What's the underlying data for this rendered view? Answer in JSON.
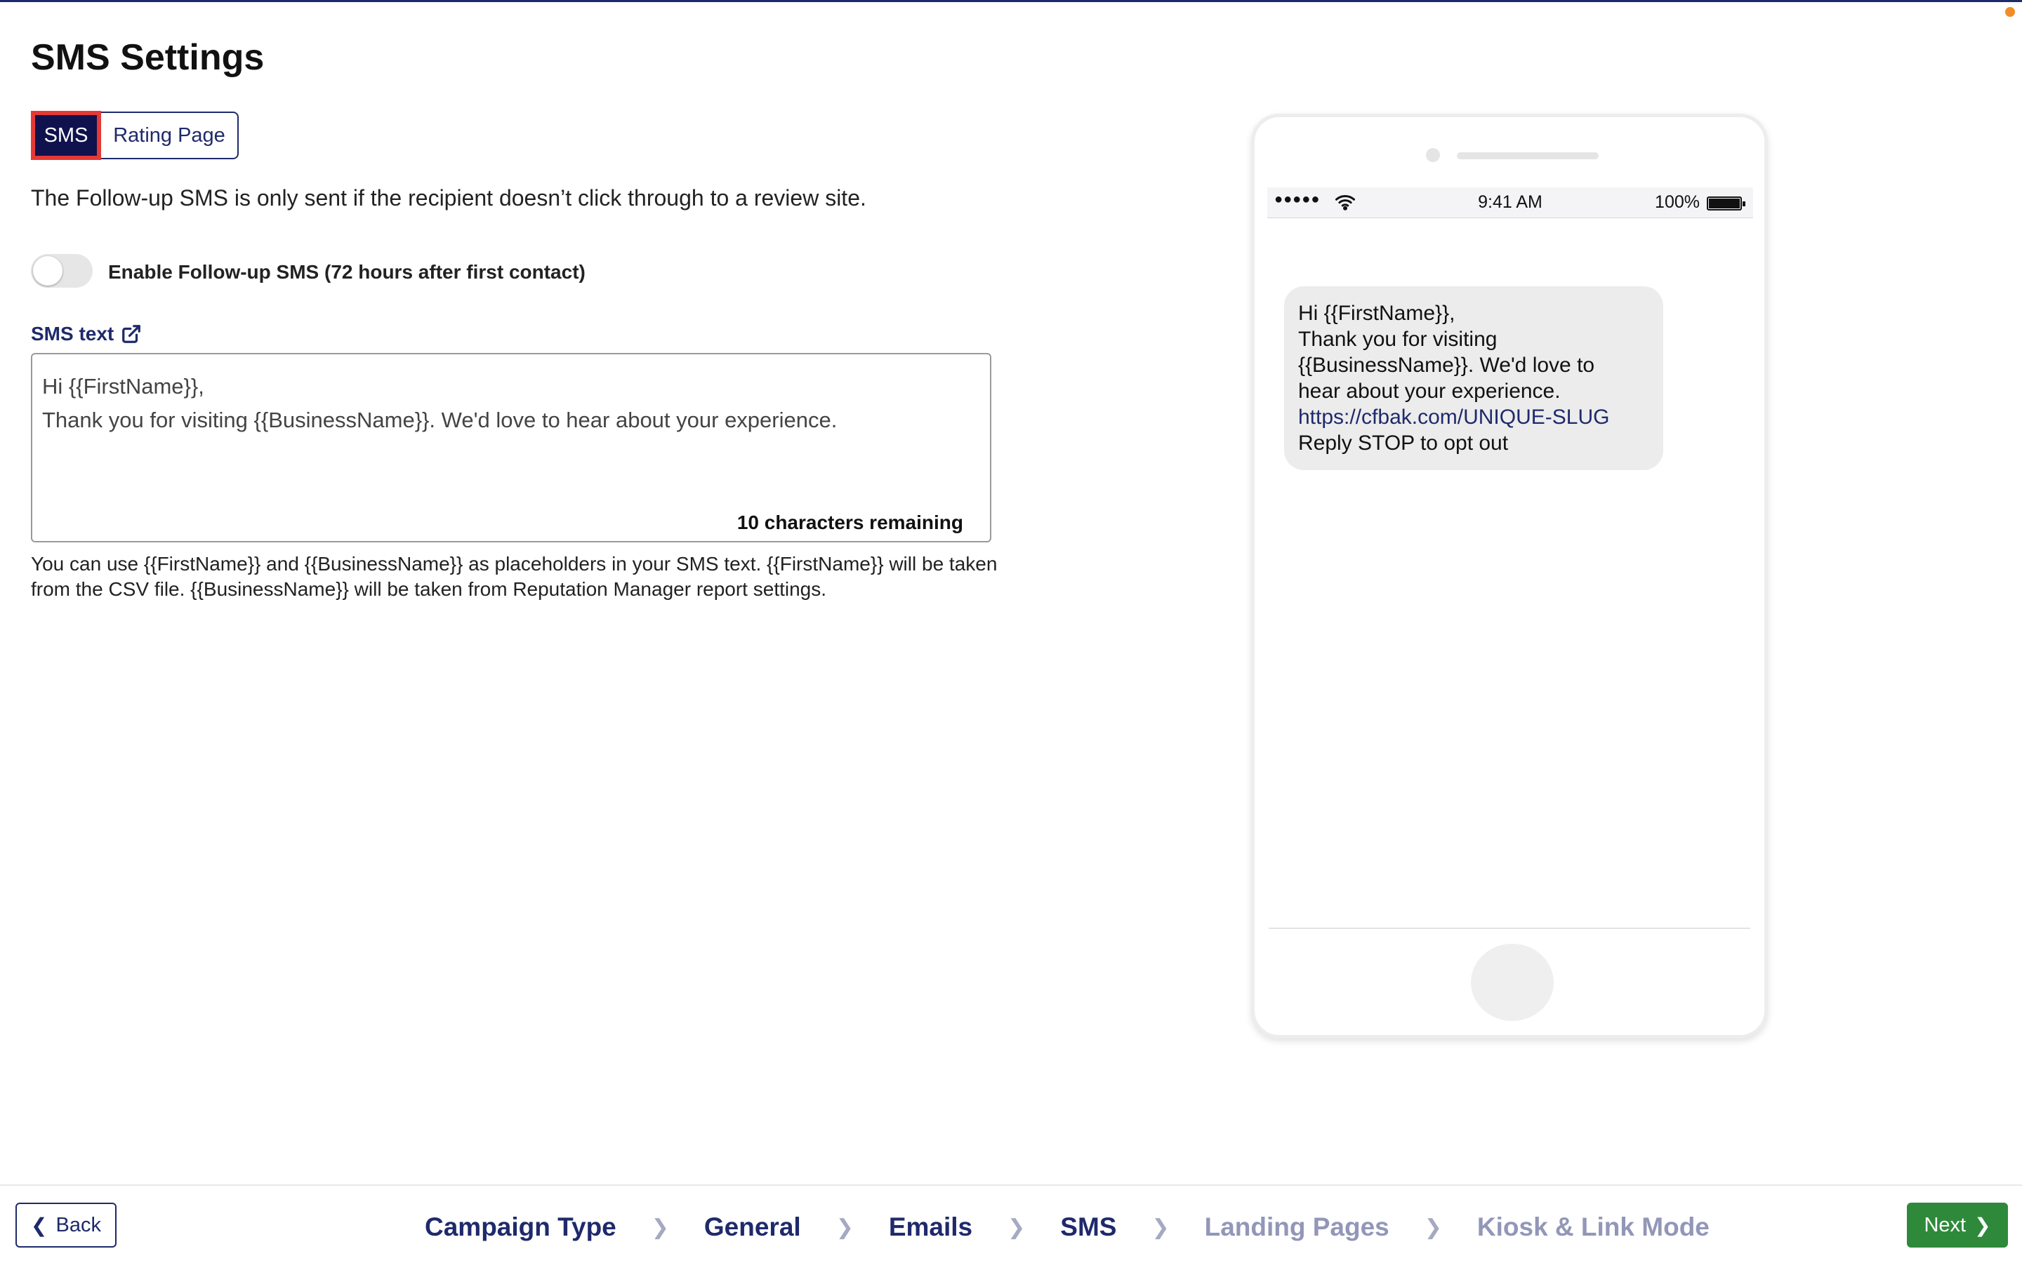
{
  "page": {
    "title": "SMS Settings"
  },
  "tabs": [
    {
      "label": "SMS",
      "active": true
    },
    {
      "label": "Rating Page",
      "active": false
    }
  ],
  "info": "The Follow-up SMS is only sent if the recipient doesn’t click through to a review site.",
  "followup_toggle": {
    "label": "Enable Follow-up SMS (72 hours after first contact)",
    "enabled": false
  },
  "sms_text": {
    "label": "SMS text",
    "link_icon": "external-link-icon",
    "lines": [
      "Hi {{FirstName}},",
      "Thank you for visiting {{BusinessName}}. We'd love to hear about your experience."
    ],
    "remaining": "10 characters remaining"
  },
  "help": "You can use {{FirstName}} and {{BusinessName}} as placeholders in your SMS text. {{FirstName}} will be taken from the CSV file. {{BusinessName}} will be taken from Reputation Manager report settings.",
  "phone_preview": {
    "signal": "●●●●●",
    "time": "9:41 AM",
    "battery": "100%",
    "message_lines": [
      "Hi {{FirstName}},",
      "Thank you for visiting",
      "{{BusinessName}}. We'd love to",
      "hear about your experience."
    ],
    "link": "https://cfbak.com/UNIQUE-SLUG",
    "opt_out": "Reply STOP to opt out"
  },
  "footer": {
    "back_label": "Back",
    "next_label": "Next",
    "steps": [
      {
        "label": "Campaign Type",
        "state": "done"
      },
      {
        "label": "General",
        "state": "done"
      },
      {
        "label": "Emails",
        "state": "done"
      },
      {
        "label": "SMS",
        "state": "done"
      },
      {
        "label": "Landing Pages",
        "state": "pending"
      },
      {
        "label": "Kiosk & Link Mode",
        "state": "pending"
      }
    ]
  },
  "colors": {
    "brand_navy": "#1e2a6b",
    "active_tab": "#10124d",
    "highlight_border": "#e53935",
    "next_button": "#2e8a3a"
  }
}
